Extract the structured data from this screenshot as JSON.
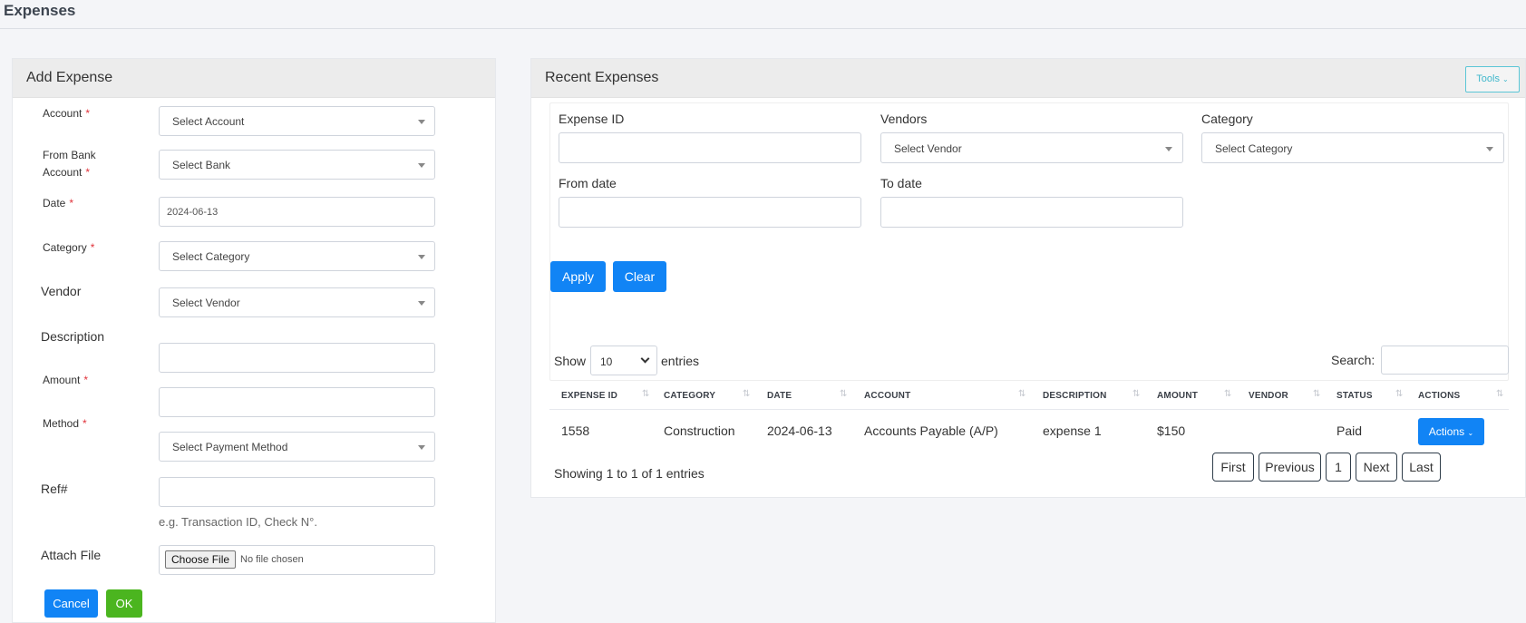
{
  "page": {
    "title": "Expenses"
  },
  "add_expense": {
    "title": "Add Expense",
    "fields": {
      "account": {
        "label": "Account",
        "placeholder": "Select Account",
        "required": "*"
      },
      "from_bank": {
        "label_line1": "From Bank",
        "label_line2": "Account",
        "placeholder": "Select Bank",
        "required": "*"
      },
      "date": {
        "label": "Date",
        "value": "2024-06-13",
        "required": "*"
      },
      "category": {
        "label": "Category",
        "placeholder": "Select Category",
        "required": "*"
      },
      "vendor": {
        "label": "Vendor",
        "placeholder": "Select Vendor"
      },
      "description": {
        "label": "Description",
        "value": ""
      },
      "amount": {
        "label": "Amount",
        "value": "",
        "required": "*"
      },
      "method": {
        "label": "Method",
        "placeholder": "Select Payment Method",
        "required": "*"
      },
      "ref": {
        "label": "Ref#",
        "value": "",
        "hint": "e.g. Transaction ID, Check N°."
      },
      "attach": {
        "label": "Attach File",
        "button": "Choose File",
        "status": "No file chosen"
      }
    },
    "buttons": {
      "cancel": "Cancel",
      "ok": "OK"
    }
  },
  "recent_expenses": {
    "title": "Recent Expenses",
    "tools_label": "Tools",
    "filters": {
      "expense_id": {
        "label": "Expense ID",
        "value": ""
      },
      "vendors": {
        "label": "Vendors",
        "placeholder": "Select Vendor"
      },
      "category": {
        "label": "Category",
        "placeholder": "Select Category"
      },
      "from_date": {
        "label": "From date",
        "value": ""
      },
      "to_date": {
        "label": "To date",
        "value": ""
      },
      "apply": "Apply",
      "clear": "Clear"
    },
    "table": {
      "show_label": "Show",
      "page_length": "10",
      "entries_label": "entries",
      "search_label": "Search:",
      "search_value": "",
      "columns": [
        "EXPENSE ID",
        "CATEGORY",
        "DATE",
        "ACCOUNT",
        "DESCRIPTION",
        "AMOUNT",
        "VENDOR",
        "STATUS",
        "ACTIONS"
      ],
      "rows": [
        {
          "id": "1558",
          "category": "Construction",
          "date": "2024-06-13",
          "account": "Accounts Payable (A/P)",
          "description": "expense 1",
          "amount": "$150",
          "vendor": "",
          "status": "Paid",
          "actions": "Actions"
        }
      ],
      "info": "Showing 1 to 1 of 1 entries",
      "pagination": {
        "first": "First",
        "previous": "Previous",
        "current": "1",
        "next": "Next",
        "last": "Last"
      }
    }
  },
  "colors": {
    "primary": "#1184f5",
    "success": "#4bb51f",
    "required": "#e0323a",
    "tools": "#41b8cc",
    "background": "#f4f5f8"
  }
}
